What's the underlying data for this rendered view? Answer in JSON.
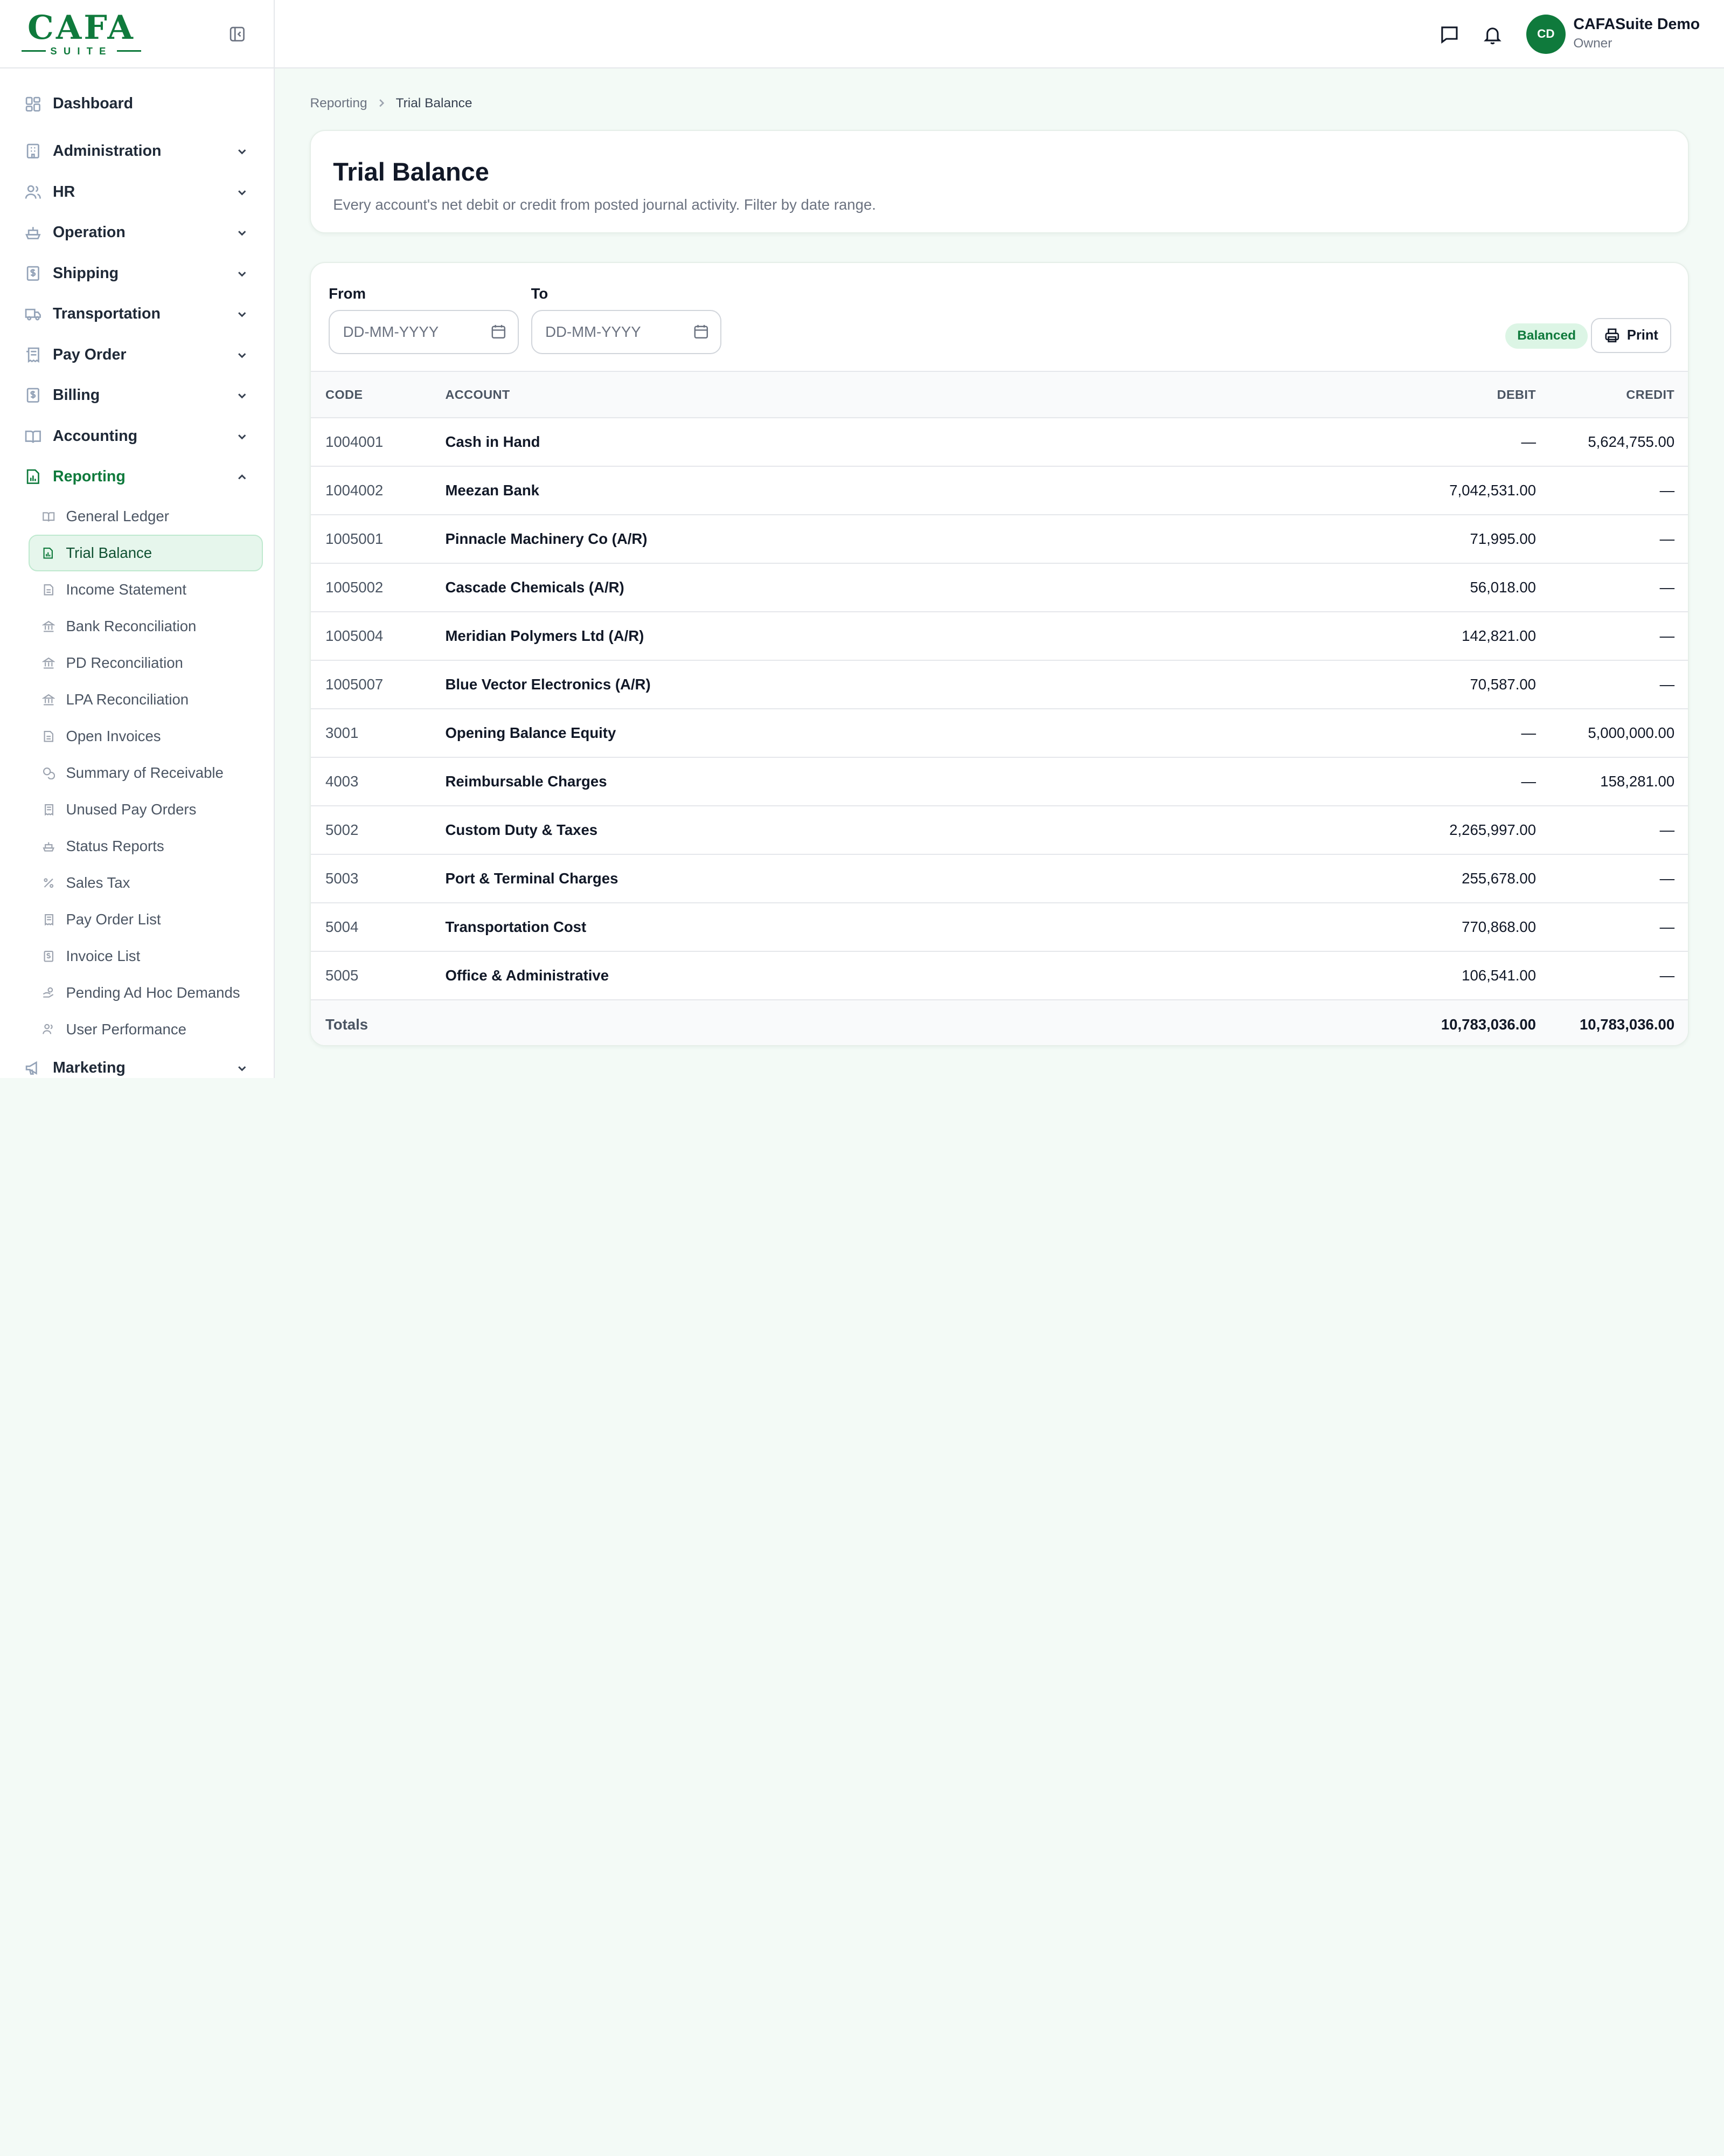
{
  "brand": {
    "logo_text": "CAFA",
    "logo_sub": "SUITE"
  },
  "sidebar": {
    "dashboard": "Dashboard",
    "groups": [
      {
        "label": "Administration",
        "icon": "building-icon"
      },
      {
        "label": "HR",
        "icon": "users-icon"
      },
      {
        "label": "Operation",
        "icon": "ship-icon"
      },
      {
        "label": "Shipping",
        "icon": "dollar-file-icon"
      },
      {
        "label": "Transportation",
        "icon": "truck-icon"
      },
      {
        "label": "Pay Order",
        "icon": "receipt-icon"
      },
      {
        "label": "Billing",
        "icon": "dollar-file-icon"
      },
      {
        "label": "Accounting",
        "icon": "book-icon"
      }
    ],
    "reporting": {
      "label": "Reporting",
      "items": [
        {
          "label": "General Ledger",
          "icon": "book-icon"
        },
        {
          "label": "Trial Balance",
          "icon": "chart-file-icon"
        },
        {
          "label": "Income Statement",
          "icon": "file-icon"
        },
        {
          "label": "Bank Reconciliation",
          "icon": "bank-icon"
        },
        {
          "label": "PD Reconciliation",
          "icon": "bank-icon"
        },
        {
          "label": "LPA Reconciliation",
          "icon": "bank-icon"
        },
        {
          "label": "Open Invoices",
          "icon": "file-icon"
        },
        {
          "label": "Summary of Receivable",
          "icon": "coins-icon"
        },
        {
          "label": "Unused Pay Orders",
          "icon": "receipt-icon"
        },
        {
          "label": "Status Reports",
          "icon": "ship-icon"
        },
        {
          "label": "Sales Tax",
          "icon": "percent-icon"
        },
        {
          "label": "Pay Order List",
          "icon": "receipt-icon"
        },
        {
          "label": "Invoice List",
          "icon": "dollar-file-icon"
        },
        {
          "label": "Pending Ad Hoc Demands",
          "icon": "hand-coins-icon"
        },
        {
          "label": "User Performance",
          "icon": "users-icon"
        }
      ]
    },
    "marketing": "Marketing"
  },
  "topbar": {
    "avatar_initials": "CD",
    "user_name": "CAFASuite Demo",
    "user_role": "Owner"
  },
  "breadcrumb": {
    "parent": "Reporting",
    "current": "Trial Balance"
  },
  "page": {
    "title": "Trial Balance",
    "description": "Every account's net debit or credit from posted journal activity. Filter by date range."
  },
  "filters": {
    "from_label": "From",
    "to_label": "To",
    "from_placeholder": "DD-MM-YYYY",
    "to_placeholder": "DD-MM-YYYY"
  },
  "status_badge": "Balanced",
  "print_label": "Print",
  "table": {
    "headers": {
      "code": "CODE",
      "account": "ACCOUNT",
      "debit": "DEBIT",
      "credit": "CREDIT"
    },
    "rows": [
      {
        "code": "1004001",
        "account": "Cash in Hand",
        "debit": "—",
        "credit": "5,624,755.00"
      },
      {
        "code": "1004002",
        "account": "Meezan Bank",
        "debit": "7,042,531.00",
        "credit": "—"
      },
      {
        "code": "1005001",
        "account": "Pinnacle Machinery Co (A/R)",
        "debit": "71,995.00",
        "credit": "—"
      },
      {
        "code": "1005002",
        "account": "Cascade Chemicals (A/R)",
        "debit": "56,018.00",
        "credit": "—"
      },
      {
        "code": "1005004",
        "account": "Meridian Polymers Ltd (A/R)",
        "debit": "142,821.00",
        "credit": "—"
      },
      {
        "code": "1005007",
        "account": "Blue Vector Electronics (A/R)",
        "debit": "70,587.00",
        "credit": "—"
      },
      {
        "code": "3001",
        "account": "Opening Balance Equity",
        "debit": "—",
        "credit": "5,000,000.00"
      },
      {
        "code": "4003",
        "account": "Reimbursable Charges",
        "debit": "—",
        "credit": "158,281.00"
      },
      {
        "code": "5002",
        "account": "Custom Duty & Taxes",
        "debit": "2,265,997.00",
        "credit": "—"
      },
      {
        "code": "5003",
        "account": "Port & Terminal Charges",
        "debit": "255,678.00",
        "credit": "—"
      },
      {
        "code": "5004",
        "account": "Transportation Cost",
        "debit": "770,868.00",
        "credit": "—"
      },
      {
        "code": "5005",
        "account": "Office & Administrative",
        "debit": "106,541.00",
        "credit": "—"
      }
    ],
    "totals": {
      "label": "Totals",
      "debit": "10,783,036.00",
      "credit": "10,783,036.00"
    }
  },
  "colors": {
    "accent": "#0f7a3c",
    "active_bg": "#e6f6ec",
    "badge_bg": "#dcf5e5",
    "page_bg": "#f3faf6"
  }
}
